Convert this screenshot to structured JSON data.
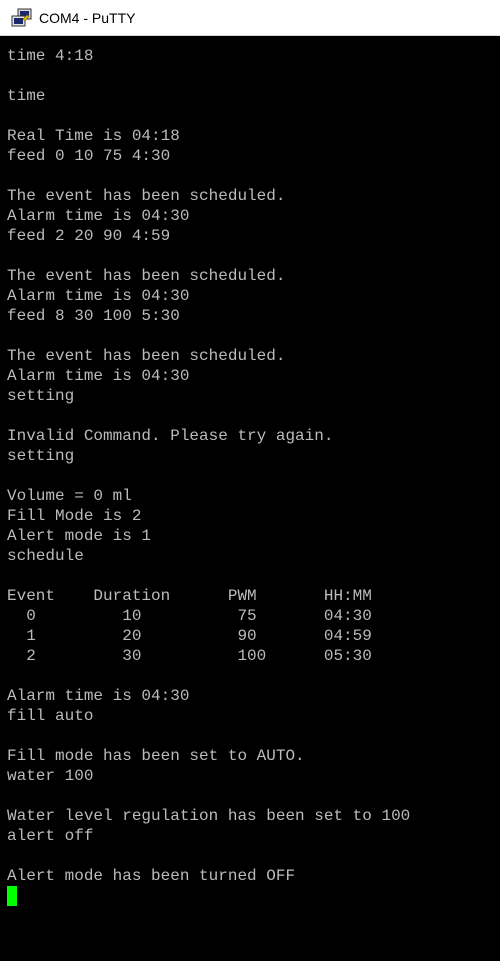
{
  "window": {
    "title": "COM4 - PuTTY",
    "icon": "putty-terminal-icon",
    "cursor_color": "#00ff00",
    "text_color": "#bbbbbb",
    "background_color": "#000000"
  },
  "terminal": {
    "lines": [
      "time 4:18",
      "",
      "time",
      "",
      "Real Time is 04:18",
      "feed 0 10 75 4:30",
      "",
      "The event has been scheduled.",
      "Alarm time is 04:30",
      "feed 2 20 90 4:59",
      "",
      "The event has been scheduled.",
      "Alarm time is 04:30",
      "feed 8 30 100 5:30",
      "",
      "The event has been scheduled.",
      "Alarm time is 04:30",
      "setting",
      "",
      "Invalid Command. Please try again.",
      "setting",
      "",
      "Volume = 0 ml",
      "Fill Mode is 2",
      "Alert mode is 1",
      "schedule",
      "",
      "Event    Duration      PWM       HH:MM",
      "  0         10          75       04:30",
      "  1         20          90       04:59",
      "  2         30          100      05:30",
      "",
      "Alarm time is 04:30",
      "fill auto",
      "",
      "Fill mode has been set to AUTO.",
      "water 100",
      "",
      "Water level regulation has been set to 100",
      "alert off",
      "",
      "Alert mode has been turned OFF"
    ]
  }
}
